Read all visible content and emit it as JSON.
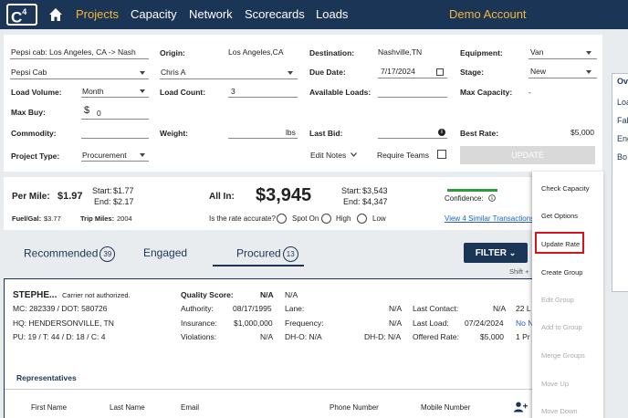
{
  "nav": {
    "logo": "C",
    "logo_sup": "4",
    "items": [
      "Projects",
      "Capacity",
      "Network",
      "Scorecards",
      "Loads"
    ],
    "account": "Demo Account"
  },
  "form": {
    "project_name": "Pepsi cab: Los Angeles, CA -> Nash",
    "customer": "Pepsi Cab",
    "load_volume_label": "Load Volume:",
    "load_volume": "Month",
    "max_buy_label": "Max Buy:",
    "max_buy_currency": "$",
    "max_buy": "0",
    "commodity_label": "Commodity:",
    "project_type_label": "Project Type:",
    "project_type": "Procurement",
    "origin_label": "Origin:",
    "origin": "Los Angeles,CA",
    "owner": "Chris A",
    "load_count_label": "Load Count:",
    "load_count": "3",
    "weight_label": "Weight:",
    "weight_unit": "lbs",
    "destination_label": "Destination:",
    "destination": "Nashville,TN",
    "due_date_label": "Due Date:",
    "due_date": "7/17/2024",
    "available_loads_label": "Available Loads:",
    "last_bid_label": "Last Bid:",
    "edit_notes": "Edit Notes",
    "require_teams_label": "Require Teams",
    "equipment_label": "Equipment:",
    "equipment": "Van",
    "stage_label": "Stage:",
    "stage": "New",
    "max_capacity_label": "Max Capacity:",
    "max_capacity": "-",
    "best_rate_label": "Best Rate:",
    "best_rate": "$5,000",
    "update_button": "UPDATE"
  },
  "right_panel": {
    "title": "Ove",
    "items": [
      "Loa",
      "Fal",
      "Eng",
      "Bo"
    ]
  },
  "rates": {
    "per_mile_label": "Per Mile:",
    "per_mile": "$1.97",
    "pm_start_label": "Start:",
    "pm_start": "$1.77",
    "pm_end_label": "End:",
    "pm_end": "$2.17",
    "fuel_label": "Fuel/Gal:",
    "fuel": "$3.77",
    "trip_miles_label": "Trip Miles:",
    "trip_miles": "2004",
    "all_in_label": "All In:",
    "all_in": "$3,945",
    "ai_start_label": "Start:",
    "ai_start": "$3,543",
    "ai_end_label": "End:",
    "ai_end": "$4,347",
    "accurate_question": "Is the rate accurate?",
    "options": [
      "Spot On",
      "High",
      "Low"
    ],
    "confidence_label": "Confidence:",
    "similar_link": "View 4 Similar Transactions"
  },
  "tabs": {
    "items": [
      {
        "label": "Recommended",
        "count": "39"
      },
      {
        "label": "Engaged",
        "count": ""
      },
      {
        "label": "Procured",
        "count": "13"
      }
    ],
    "filter": "FILTER",
    "shift_hint": "Shift +"
  },
  "carrier": {
    "name": "STEPHE...",
    "warning": "Carrier not authorized.",
    "mc_dot": "MC: 282339 / DOT: 580726",
    "hq": "HQ:  HENDERSONVILLE, TN",
    "pu_line": "PU: 19  /  T: 44  /  D: 18 / C: 4",
    "quality_label": "Quality Score:",
    "quality": "N/A",
    "quality_extra": "N/A",
    "authority_label": "Authority:",
    "authority": "08/17/1995",
    "insurance_label": "Insurance:",
    "insurance": "$1,000,000",
    "violations_label": "Violations:",
    "violations": "N/A",
    "lane_label": "Lane:",
    "lane": "N/A",
    "frequency_label": "Frequency:",
    "frequency": "N/A",
    "dh_o": "DH-O: N/A",
    "dh_d": "DH-D: N/A",
    "last_contact_label": "Last Contact:",
    "last_contact": "N/A",
    "last_load_label": "Last Load:",
    "last_load": "07/24/2024",
    "offered_rate_label": "Offered Rate:",
    "offered_rate": "$5,000",
    "col_r1": "22 L",
    "col_r2": "No N",
    "col_r3": "1 Pr",
    "representatives_label": "Representatives",
    "rep_columns": [
      "First Name",
      "Last Name",
      "Email",
      "Phone Number",
      "Mobile Number"
    ]
  },
  "context_menu": {
    "items": [
      {
        "label": "Check Capacity",
        "enabled": true
      },
      {
        "label": "Get Options",
        "enabled": true
      },
      {
        "label": "Update Rate",
        "enabled": true
      },
      {
        "label": "Create Group",
        "enabled": true
      },
      {
        "label": "Edit Group",
        "enabled": false
      },
      {
        "label": "Add to Group",
        "enabled": false
      },
      {
        "label": "Merge Groups",
        "enabled": false
      },
      {
        "label": "Move Up",
        "enabled": false
      },
      {
        "label": "Move Down",
        "enabled": false
      }
    ]
  },
  "colors": {
    "nav_bg": "#1b3556",
    "accent": "#f5b73a",
    "highlight": "#d9131b",
    "confidence": "#2a9d3a",
    "link": "#1f5fbf"
  }
}
